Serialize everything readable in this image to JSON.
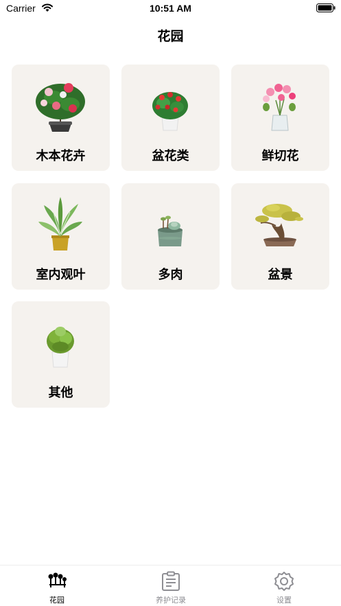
{
  "status_bar": {
    "carrier": "Carrier",
    "time": "10:51 AM"
  },
  "nav": {
    "title": "花园"
  },
  "categories": [
    {
      "label": "木本花卉",
      "icon": "camellia-plant-icon"
    },
    {
      "label": "盆花类",
      "icon": "potted-flower-icon"
    },
    {
      "label": "鲜切花",
      "icon": "cut-flowers-vase-icon"
    },
    {
      "label": "室内观叶",
      "icon": "foliage-plant-icon"
    },
    {
      "label": "多肉",
      "icon": "succulent-icon"
    },
    {
      "label": "盆景",
      "icon": "bonsai-icon"
    },
    {
      "label": "其他",
      "icon": "other-plant-icon"
    }
  ],
  "tabbar": {
    "tabs": [
      {
        "label": "花园",
        "icon": "garden-icon",
        "active": true
      },
      {
        "label": "养护记录",
        "icon": "clipboard-icon",
        "active": false
      },
      {
        "label": "设置",
        "icon": "gear-icon",
        "active": false
      }
    ]
  },
  "colors": {
    "card_bg": "#f5f2ee",
    "tab_active": "#000000",
    "tab_inactive": "#8e8e93"
  }
}
